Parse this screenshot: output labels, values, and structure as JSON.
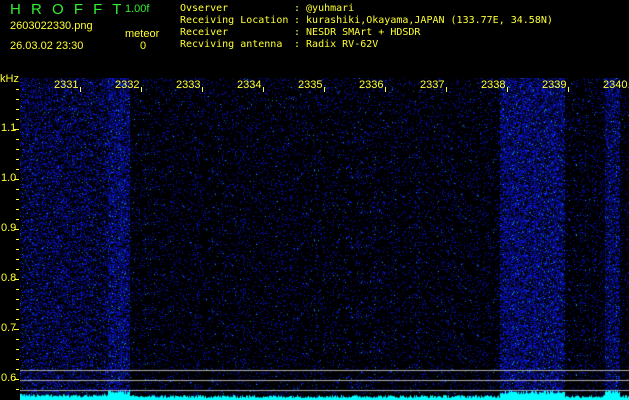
{
  "header": {
    "logo": "H R O F F T",
    "version": "1.00f",
    "filename": "2603022330.png",
    "datetime": "26.03.02 23:30",
    "meteor_label": "meteor",
    "meteor_count": "0"
  },
  "info": {
    "labels": [
      "Ovserver",
      "Receiving Location",
      "Receiver",
      "Recviving antenna"
    ],
    "values": [
      ": @yuhmari",
      ": kurashiki,Okayama,JAPAN (133.77E, 34.58N)",
      ": NESDR SMArt + HDSDR",
      ": Radix RV-62V"
    ]
  },
  "axis": {
    "unit": "kHz",
    "y_labels": [
      "1.1",
      "1.0",
      "0.9",
      "0.8",
      "0.7",
      "0.6"
    ],
    "x_labels": [
      "2331",
      "2332",
      "2333",
      "2334",
      "2335",
      "2336",
      "2337",
      "2338",
      "2339",
      "2340"
    ]
  },
  "colors": {
    "label": "#ffff33",
    "logo": "#33ee33",
    "signal": "#2233ff",
    "level": "#00ffff"
  }
}
